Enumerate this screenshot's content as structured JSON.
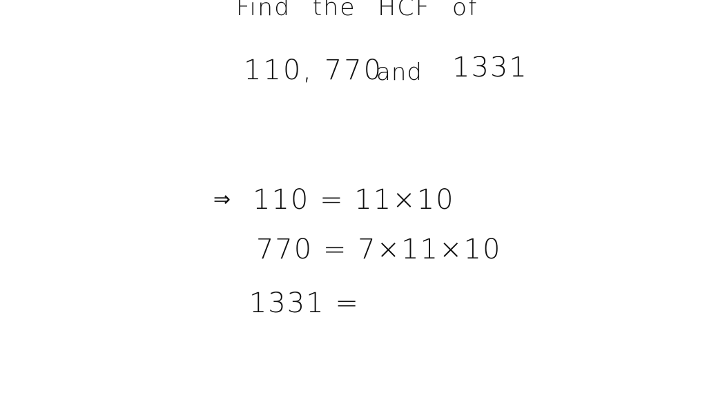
{
  "note": {
    "title": "Find the HCF of",
    "problem": {
      "numbers_text": "110, 770",
      "conjunction": "and",
      "last_number": "1331"
    },
    "steps": [
      {
        "prefix": "⇒",
        "expression": "110 = 11×10"
      },
      {
        "prefix": "",
        "expression": "770 = 7×11×10"
      },
      {
        "prefix": "",
        "expression": "1331 ="
      }
    ]
  },
  "colors": {
    "background": "#ffffff",
    "ink": "#111111"
  }
}
